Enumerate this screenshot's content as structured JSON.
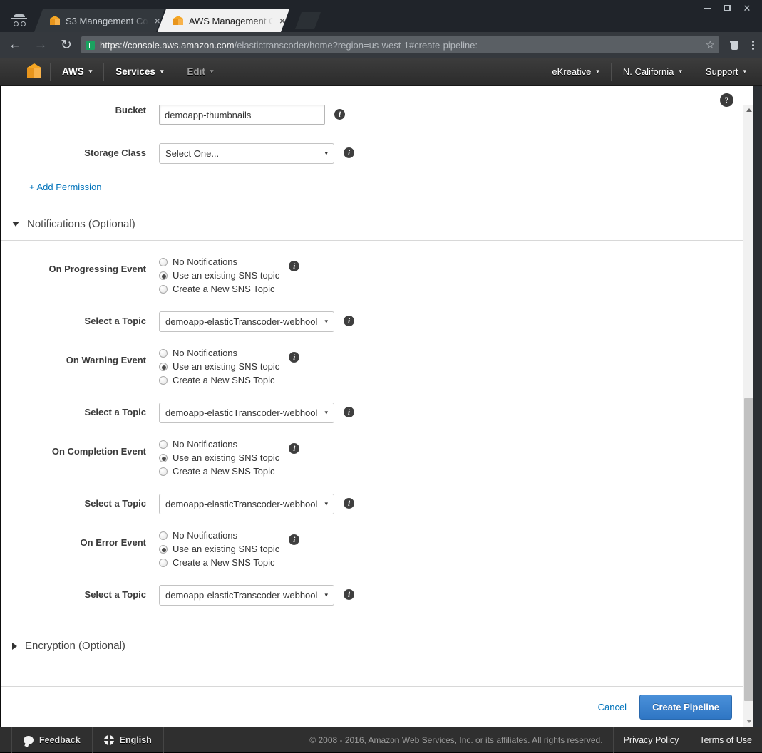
{
  "browser": {
    "incognito_icon": "incognito-icon",
    "tabs": [
      {
        "title": "S3 Management Co",
        "favicon": "aws-cube-icon",
        "active": false
      },
      {
        "title": "AWS Management C",
        "favicon": "aws-cube-icon",
        "active": true
      }
    ],
    "close_glyph": "×",
    "window_controls": {
      "minimize": "minimize",
      "maximize": "maximize",
      "close": "close"
    },
    "nav": {
      "back": "←",
      "forward": "→",
      "reload": "↻"
    },
    "url_secure": "https://console.aws.amazon.com",
    "url_path": "/elastictranscoder/home?region=us-west-1#create-pipeline:",
    "star_glyph": "☆"
  },
  "awsnav": {
    "logo": "aws-cube-logo",
    "items": [
      {
        "label": "AWS",
        "caret": "▾",
        "muted": false
      },
      {
        "label": "Services",
        "caret": "▾",
        "muted": false
      },
      {
        "label": "Edit",
        "caret": "▾",
        "muted": true
      }
    ],
    "right_items": [
      {
        "label": "eKreative",
        "caret": "▾"
      },
      {
        "label": "N. California",
        "caret": "▾"
      },
      {
        "label": "Support",
        "caret": "▾"
      }
    ]
  },
  "page": {
    "help_glyph": "?",
    "info_glyph": "i",
    "bucket": {
      "label": "Bucket",
      "value": "demoapp-thumbnails",
      "placeholder": ""
    },
    "storage_class": {
      "label": "Storage Class",
      "value": "Select One...",
      "arrow": "▾"
    },
    "add_permission": "+ Add Permission",
    "notifications_section": {
      "title": "Notifications (Optional)",
      "expanded": true,
      "radio_options": [
        "No Notifications",
        "Use an existing SNS topic",
        "Create a New SNS Topic"
      ],
      "selected_option": "Use an existing SNS topic",
      "topic_label": "Select a Topic",
      "topic_value": "demoapp-elasticTranscoder-webhool",
      "events": [
        {
          "label": "On Progressing Event"
        },
        {
          "label": "On Warning Event"
        },
        {
          "label": "On Completion Event"
        },
        {
          "label": "On Error Event"
        }
      ]
    },
    "encryption_section": {
      "title": "Encryption (Optional)",
      "expanded": false
    },
    "actions": {
      "cancel": "Cancel",
      "submit": "Create Pipeline"
    }
  },
  "footer": {
    "feedback": "Feedback",
    "language": "English",
    "copyright": "© 2008 - 2016, Amazon Web Services, Inc. or its affiliates. All rights reserved.",
    "links": [
      "Privacy Policy",
      "Terms of Use"
    ]
  },
  "colors": {
    "accent_blue": "#0073bb",
    "button_blue": "#3a81cd",
    "aws_orange": "#f5a623"
  }
}
